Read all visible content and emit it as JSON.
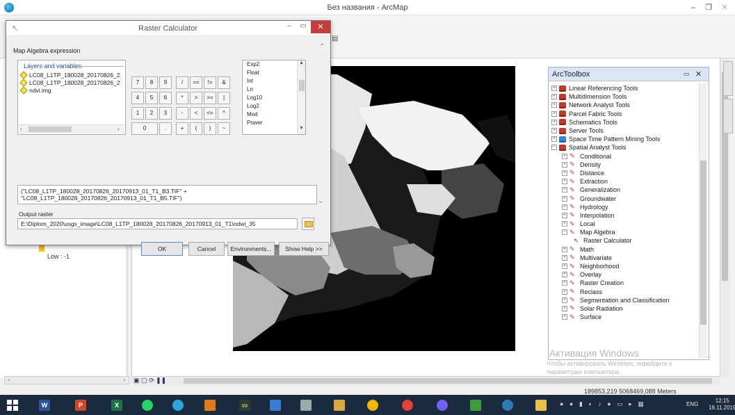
{
  "app": {
    "title": "Без названия - ArcMap"
  },
  "toc": {
    "legend_low": "Low : -1"
  },
  "status": {
    "coordinates": "189853,219  5068469,088 Meters"
  },
  "toolbox": {
    "title": "ArcToolbox",
    "items": [
      {
        "label": "Linear Referencing Tools",
        "level": 1,
        "kind": "box"
      },
      {
        "label": "Multidimension Tools",
        "level": 1,
        "kind": "box"
      },
      {
        "label": "Network Analyst Tools",
        "level": 1,
        "kind": "box"
      },
      {
        "label": "Parcel Fabric Tools",
        "level": 1,
        "kind": "box"
      },
      {
        "label": "Schematics Tools",
        "level": 1,
        "kind": "box"
      },
      {
        "label": "Server Tools",
        "level": 1,
        "kind": "box"
      },
      {
        "label": "Space Time Pattern Mining Tools",
        "level": 1,
        "kind": "box-blue"
      },
      {
        "label": "Spatial Analyst Tools",
        "level": 1,
        "kind": "box",
        "expanded": true
      },
      {
        "label": "Conditional",
        "level": 2,
        "kind": "tool"
      },
      {
        "label": "Density",
        "level": 2,
        "kind": "tool"
      },
      {
        "label": "Distance",
        "level": 2,
        "kind": "tool"
      },
      {
        "label": "Extraction",
        "level": 2,
        "kind": "tool"
      },
      {
        "label": "Generalization",
        "level": 2,
        "kind": "tool"
      },
      {
        "label": "Groundwater",
        "level": 2,
        "kind": "tool"
      },
      {
        "label": "Hydrology",
        "level": 2,
        "kind": "tool"
      },
      {
        "label": "Interpolation",
        "level": 2,
        "kind": "tool"
      },
      {
        "label": "Local",
        "level": 2,
        "kind": "tool"
      },
      {
        "label": "Map Algebra",
        "level": 2,
        "kind": "tool",
        "expanded": true
      },
      {
        "label": "Raster Calculator",
        "level": 3,
        "kind": "calc"
      },
      {
        "label": "Math",
        "level": 2,
        "kind": "tool"
      },
      {
        "label": "Multivariate",
        "level": 2,
        "kind": "tool"
      },
      {
        "label": "Neighborhood",
        "level": 2,
        "kind": "tool"
      },
      {
        "label": "Overlay",
        "level": 2,
        "kind": "tool"
      },
      {
        "label": "Raster Creation",
        "level": 2,
        "kind": "tool"
      },
      {
        "label": "Reclass",
        "level": 2,
        "kind": "tool"
      },
      {
        "label": "Segmentation and Classification",
        "level": 2,
        "kind": "tool"
      },
      {
        "label": "Solar Radiation",
        "level": 2,
        "kind": "tool"
      },
      {
        "label": "Surface",
        "level": 2,
        "kind": "tool"
      }
    ]
  },
  "watermark": {
    "line1": "Активация Windows",
    "line2": "Чтобы активировать Windows, перейдите к",
    "line3": "параметрам компьютера."
  },
  "raster_calculator": {
    "title": "Raster Calculator",
    "expr_section_label": "Map Algebra expression",
    "layers_header": "Layers and variables",
    "layers": [
      "LC08_L1TP_180028_20170826_2",
      "LC08_L1TP_180028_20170826_2",
      "ndvi.img"
    ],
    "keypad": {
      "row1": [
        "7",
        "8",
        "9",
        "/",
        "==",
        "!=",
        "&"
      ],
      "row2": [
        "4",
        "5",
        "6",
        "*",
        ">",
        ">=",
        "|"
      ],
      "row3": [
        "1",
        "2",
        "3",
        "-",
        "<",
        "<=",
        "^"
      ],
      "row4": [
        "0",
        ".",
        "+",
        "(",
        ")",
        "~"
      ]
    },
    "functions": [
      "Exp2",
      "Float",
      "Int",
      "Ln",
      "Log10",
      "Log2",
      "Mod",
      "Power"
    ],
    "expression_line1": "(\"LC08_L1TP_180028_20170826_20170913_01_T1_B3.TIF\" +",
    "expression_line2": "\"LC08_L1TP_180028_20170826_20170913_01_T1_B5.TIF\")",
    "output_label": "Output raster",
    "output_value": "E:\\Diplom_2020\\usgs_image\\LC08_L1TP_180028_20170826_20170913_01_T1\\ndwi_35",
    "buttons": {
      "ok": "OK",
      "cancel": "Cancel",
      "environments": "Environments...",
      "show_help": "Show Help >>"
    }
  },
  "taskbar": {
    "lang": "ENG",
    "time": "12:15",
    "date": "18.11.2019"
  }
}
